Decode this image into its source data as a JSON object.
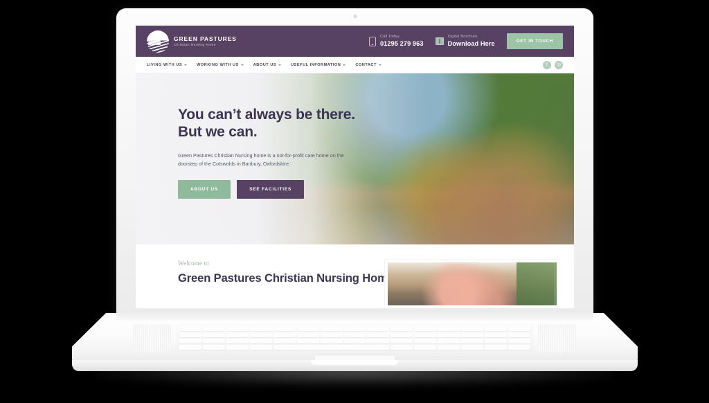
{
  "device": {
    "type": "laptop",
    "camera": "webcam-dot"
  },
  "site": {
    "header": {
      "brand": {
        "name": "GREEN PASTURES",
        "tagline": "Christian Nursing Home",
        "logo_icon": "circular-landscape-logo"
      },
      "phone": {
        "label": "Call Today",
        "value": "01295 279 963",
        "icon": "mobile-phone-icon"
      },
      "brochure": {
        "label": "Digital Brochure",
        "value": "Download Here",
        "icon": "book-icon"
      },
      "cta": "GET IN TOUCH",
      "bg_color": "#584263",
      "cta_color": "#9dc4a7"
    },
    "nav": {
      "items": [
        {
          "label": "LIVING WITH US",
          "has_dropdown": true
        },
        {
          "label": "WORKING WITH US",
          "has_dropdown": true
        },
        {
          "label": "ABOUT US",
          "has_dropdown": true
        },
        {
          "label": "USEFUL INFORMATION",
          "has_dropdown": true
        },
        {
          "label": "CONTACT",
          "has_dropdown": true
        }
      ],
      "social": [
        {
          "name": "facebook",
          "glyph": "f"
        },
        {
          "name": "instagram",
          "glyph": "◎"
        }
      ]
    },
    "hero": {
      "heading_line1": "You can’t always be there.",
      "heading_line2": "But we can.",
      "paragraph": "Green Pastures Christian Nursing home is a not-for-profit care home on the doorstep of the Cotswolds in Banbury, Oxfordshire.",
      "buttons": [
        {
          "label": "ABOUT US",
          "style": "green"
        },
        {
          "label": "SEE FACILITIES",
          "style": "purple"
        }
      ],
      "image_alt": "garden with benches, brick wall, trees and yellow flowers",
      "heading_color": "#3b3452"
    },
    "welcome": {
      "eyebrow": "Welcome to",
      "title": "Green Pastures Christian Nursing Home",
      "image_alt": "resident portrait photo",
      "eyebrow_color": "#9bb5a0"
    }
  }
}
